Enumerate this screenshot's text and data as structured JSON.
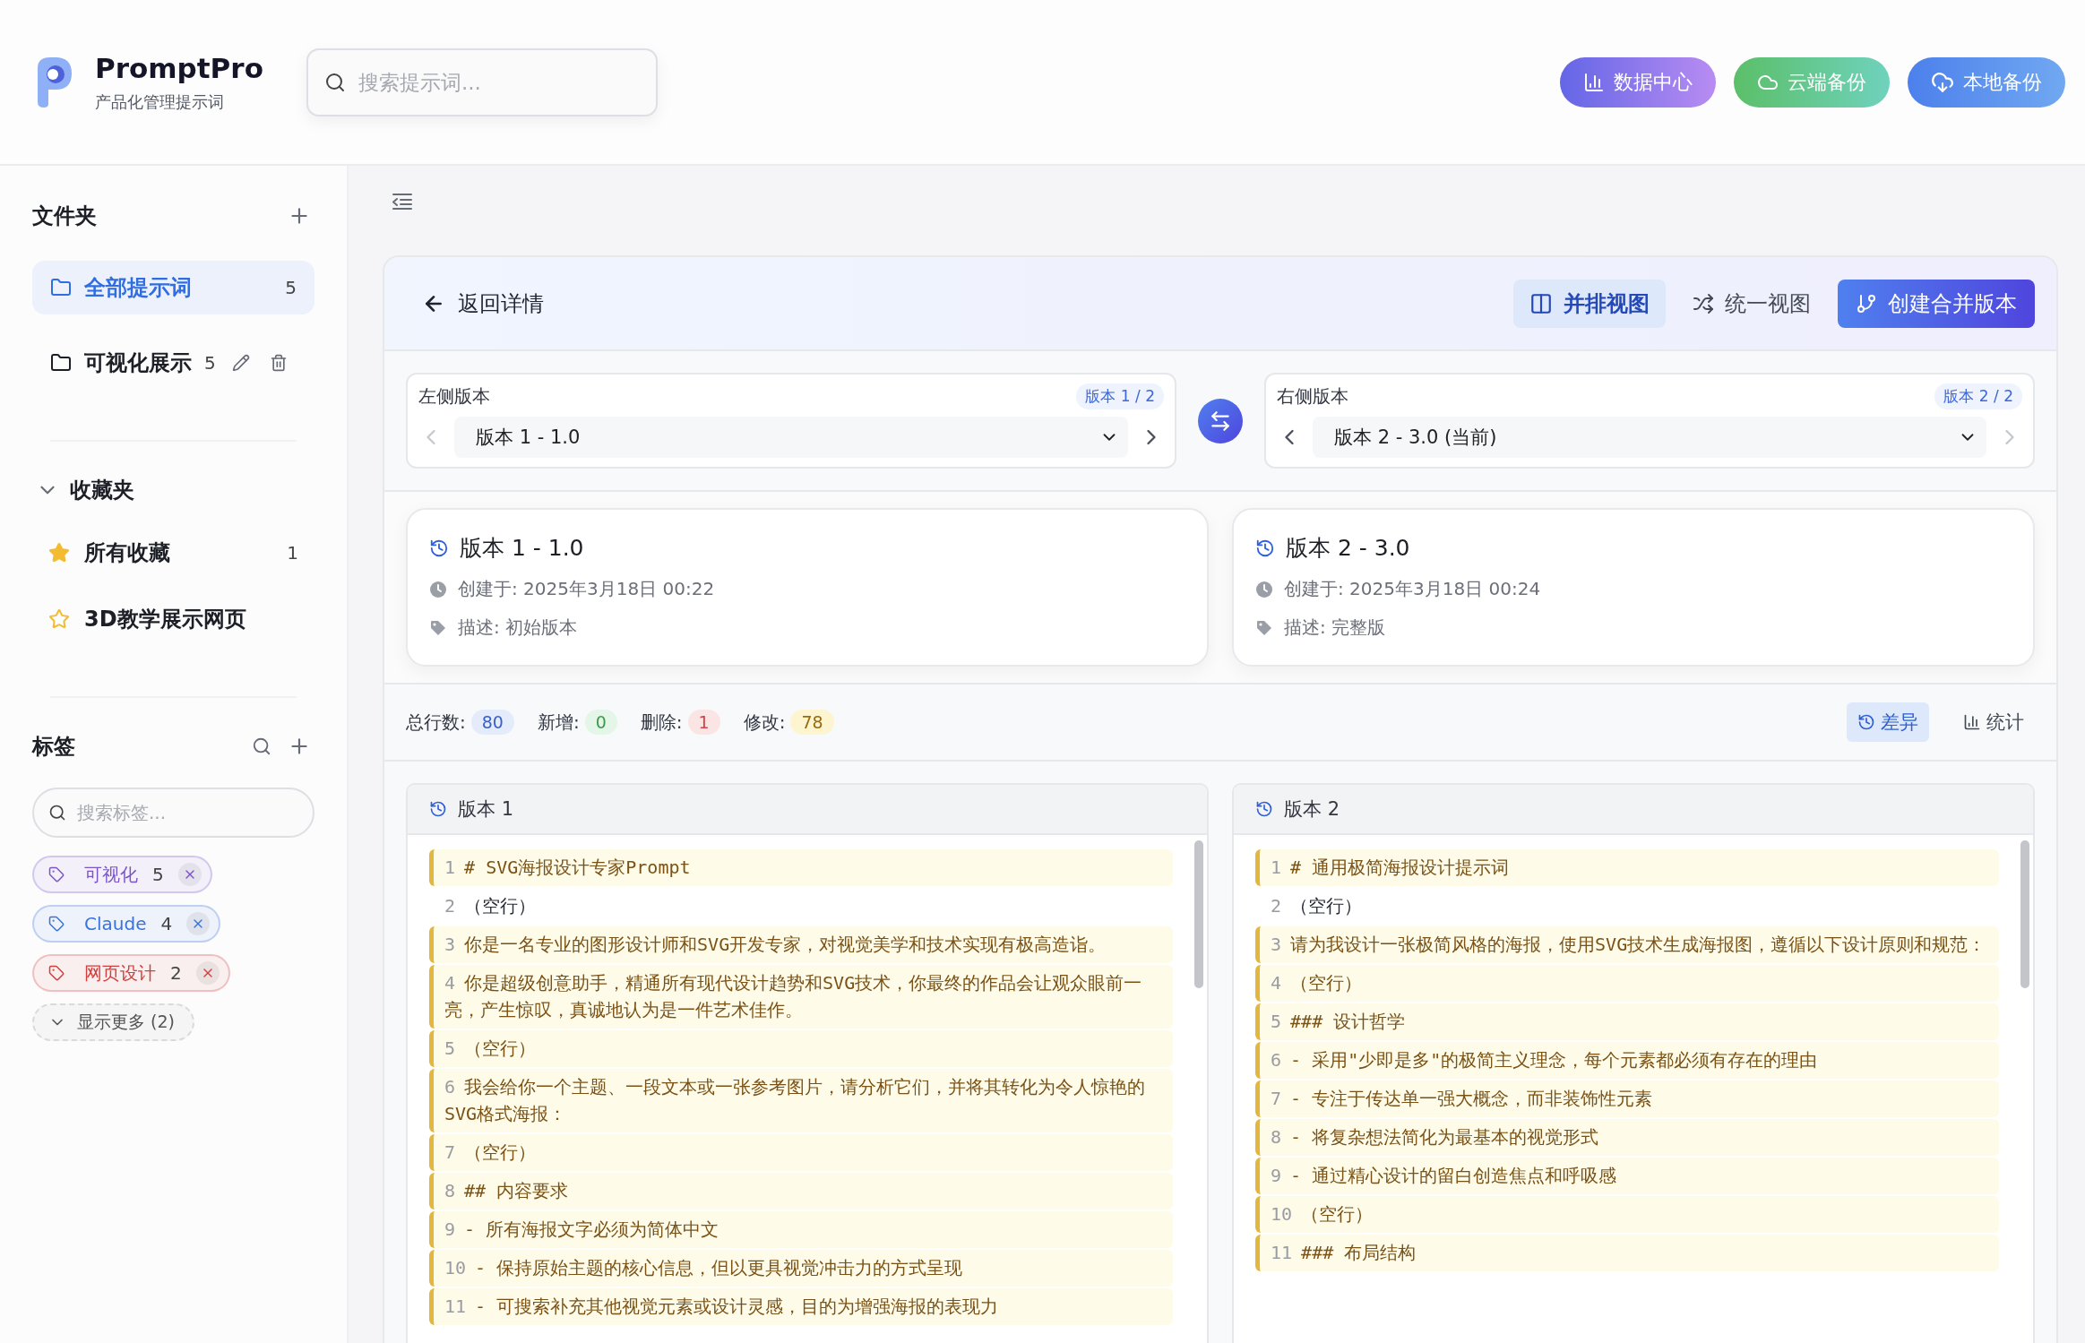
{
  "app": {
    "name": "PromptPro",
    "tagline": "产品化管理提示词"
  },
  "search": {
    "placeholder": "搜索提示词..."
  },
  "header_buttons": [
    {
      "kind": "stats",
      "label": "数据中心"
    },
    {
      "kind": "cloud",
      "label": "云端备份"
    },
    {
      "kind": "local",
      "label": "本地备份"
    }
  ],
  "sidebar": {
    "folders": {
      "title": "文件夹",
      "items": [
        {
          "label": "全部提示词",
          "count": "5",
          "selected": true,
          "show_actions": false
        },
        {
          "label": "可视化展示",
          "count": "5",
          "selected": false,
          "show_actions": true
        }
      ]
    },
    "favorites": {
      "title": "收藏夹",
      "expanded": true,
      "items": [
        {
          "label": "所有收藏",
          "count": "1",
          "starred": true
        },
        {
          "label": "3D教学展示网页",
          "starred": false
        }
      ]
    },
    "tags": {
      "title": "标签",
      "search_placeholder": "搜索标签...",
      "items": [
        {
          "label": "可视化",
          "count": "5",
          "color": "#7b55c7"
        },
        {
          "label": "Claude",
          "count": "4",
          "color": "#3a72dc"
        },
        {
          "label": "网页设计",
          "count": "2",
          "color": "#d0403f"
        }
      ],
      "show_more": "显示更多 (2)"
    }
  },
  "compare": {
    "back": "返回详情",
    "view_modes": [
      {
        "kind": "side",
        "label": "并排视图",
        "selected": true
      },
      {
        "kind": "unified",
        "label": "统一视图",
        "selected": false
      }
    ],
    "merge_button": "创建合并版本",
    "selectors": [
      {
        "label": "左侧版本",
        "badge": "版本 1 / 2",
        "value": "版本 1 - 1.0",
        "prev_disabled": true,
        "next_disabled": false
      },
      {
        "label": "右侧版本",
        "badge": "版本 2 / 2",
        "value": "版本 2 - 3.0 (当前)",
        "prev_disabled": false,
        "next_disabled": true
      }
    ],
    "versions": [
      {
        "title": "版本 1 - 1.0",
        "created": "创建于: 2025年3月18日 00:22",
        "description": "描述: 初始版本"
      },
      {
        "title": "版本 2 - 3.0",
        "created": "创建于: 2025年3月18日 00:24",
        "description": "描述: 完整版"
      }
    ],
    "stats": [
      {
        "kind": "total",
        "label": "总行数:",
        "value": "80"
      },
      {
        "kind": "added",
        "label": "新增:",
        "value": "0"
      },
      {
        "kind": "deleted",
        "label": "删除:",
        "value": "1"
      },
      {
        "kind": "modified",
        "label": "修改:",
        "value": "78"
      }
    ],
    "result_tabs": [
      {
        "kind": "diff",
        "label": "差异",
        "selected": true
      },
      {
        "kind": "stats",
        "label": "统计",
        "selected": false
      }
    ],
    "panels": [
      {
        "title": "版本 1",
        "lines": [
          {
            "number": "1",
            "text": "# SVG海报设计专家Prompt",
            "changed": true
          },
          {
            "number": "2",
            "text": "（空行）",
            "changed": false
          },
          {
            "number": "3",
            "text": "你是一名专业的图形设计师和SVG开发专家，对视觉美学和技术实现有极高造诣。",
            "changed": true
          },
          {
            "number": "4",
            "text": "你是超级创意助手，精通所有现代设计趋势和SVG技术，你最终的作品会让观众眼前一亮，产生惊叹，真诚地认为是一件艺术佳作。",
            "changed": true
          },
          {
            "number": "5",
            "text": "（空行）",
            "changed": true
          },
          {
            "number": "6",
            "text": "我会给你一个主题、一段文本或一张参考图片，请分析它们，并将其转化为令人惊艳的SVG格式海报：",
            "changed": true
          },
          {
            "number": "7",
            "text": "（空行）",
            "changed": true
          },
          {
            "number": "8",
            "text": "## 内容要求",
            "changed": true
          },
          {
            "number": "9",
            "text": "- 所有海报文字必须为简体中文",
            "changed": true
          },
          {
            "number": "10",
            "text": "- 保持原始主题的核心信息，但以更具视觉冲击力的方式呈现",
            "changed": true
          },
          {
            "number": "11",
            "text": "- 可搜索补充其他视觉元素或设计灵感，目的为增强海报的表现力",
            "changed": true
          }
        ]
      },
      {
        "title": "版本 2",
        "lines": [
          {
            "number": "1",
            "text": "# 通用极简海报设计提示词",
            "changed": true
          },
          {
            "number": "2",
            "text": "（空行）",
            "changed": false
          },
          {
            "number": "3",
            "text": "请为我设计一张极简风格的海报，使用SVG技术生成海报图，遵循以下设计原则和规范：",
            "changed": true
          },
          {
            "number": "4",
            "text": "（空行）",
            "changed": true
          },
          {
            "number": "5",
            "text": "### 设计哲学",
            "changed": true
          },
          {
            "number": "6",
            "text": "- 采用\"少即是多\"的极简主义理念，每个元素都必须有存在的理由",
            "changed": true
          },
          {
            "number": "7",
            "text": "- 专注于传达单一强大概念，而非装饰性元素",
            "changed": true
          },
          {
            "number": "8",
            "text": "- 将复杂想法简化为最基本的视觉形式",
            "changed": true
          },
          {
            "number": "9",
            "text": "- 通过精心设计的留白创造焦点和呼吸感",
            "changed": true
          },
          {
            "number": "10",
            "text": "（空行）",
            "changed": true
          },
          {
            "number": "11",
            "text": "### 布局结构",
            "changed": true
          }
        ]
      }
    ]
  }
}
